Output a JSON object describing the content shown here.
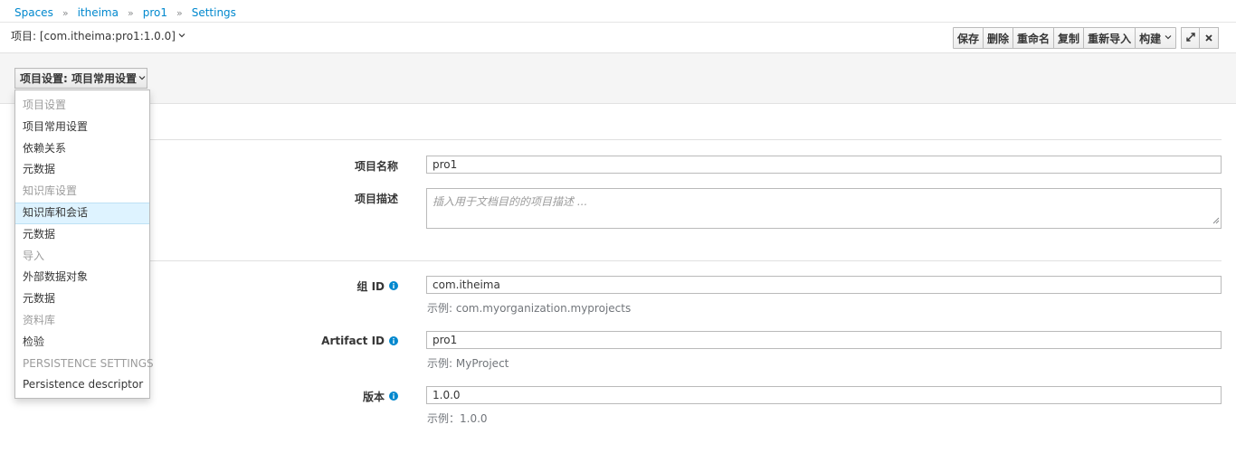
{
  "breadcrumb": {
    "items": [
      "Spaces",
      "itheima",
      "pro1",
      "Settings"
    ],
    "separator": "»"
  },
  "project": {
    "title": "项目: [com.itheima:pro1:1.0.0]"
  },
  "toolbar": {
    "save": "保存",
    "delete": "删除",
    "rename": "重命名",
    "copy": "复制",
    "reimport": "重新导入",
    "build": "构建"
  },
  "settings": {
    "selected": "项目设置: 项目常用设置"
  },
  "menu": {
    "items": [
      {
        "label": "项目设置",
        "type": "header"
      },
      {
        "label": "项目常用设置",
        "type": "item"
      },
      {
        "label": "依赖关系",
        "type": "item"
      },
      {
        "label": "元数据",
        "type": "item"
      },
      {
        "label": "知识库设置",
        "type": "header"
      },
      {
        "label": "知识库和会话",
        "type": "active"
      },
      {
        "label": "元数据",
        "type": "item"
      },
      {
        "label": "导入",
        "type": "header"
      },
      {
        "label": "外部数据对象",
        "type": "item"
      },
      {
        "label": "元数据",
        "type": "item"
      },
      {
        "label": "资料库",
        "type": "header"
      },
      {
        "label": "检验",
        "type": "item"
      },
      {
        "label": "PERSISTENCE SETTINGS",
        "type": "header"
      },
      {
        "label": "Persistence descriptor",
        "type": "item"
      }
    ]
  },
  "form": {
    "project_name_label": "项目名称",
    "project_name_value": "pro1",
    "project_desc_label": "项目描述",
    "project_desc_placeholder": "插入用于文档目的的项目描述 ...",
    "group_id_label": "组 ID",
    "group_id_value": "com.itheima",
    "group_id_help": "示例: com.myorganization.myprojects",
    "artifact_id_label": "Artifact ID",
    "artifact_id_value": "pro1",
    "artifact_id_help": "示例: MyProject",
    "version_label": "版本",
    "version_value": "1.0.0",
    "version_help": "示例：1.0.0"
  },
  "colors": {
    "link": "#0088ce",
    "info": "#0088ce",
    "active_bg": "#def3ff"
  },
  "icons": {
    "expand": "expand-icon",
    "close": "close-icon",
    "info": "info-icon",
    "caret": "chevron-down-icon"
  }
}
